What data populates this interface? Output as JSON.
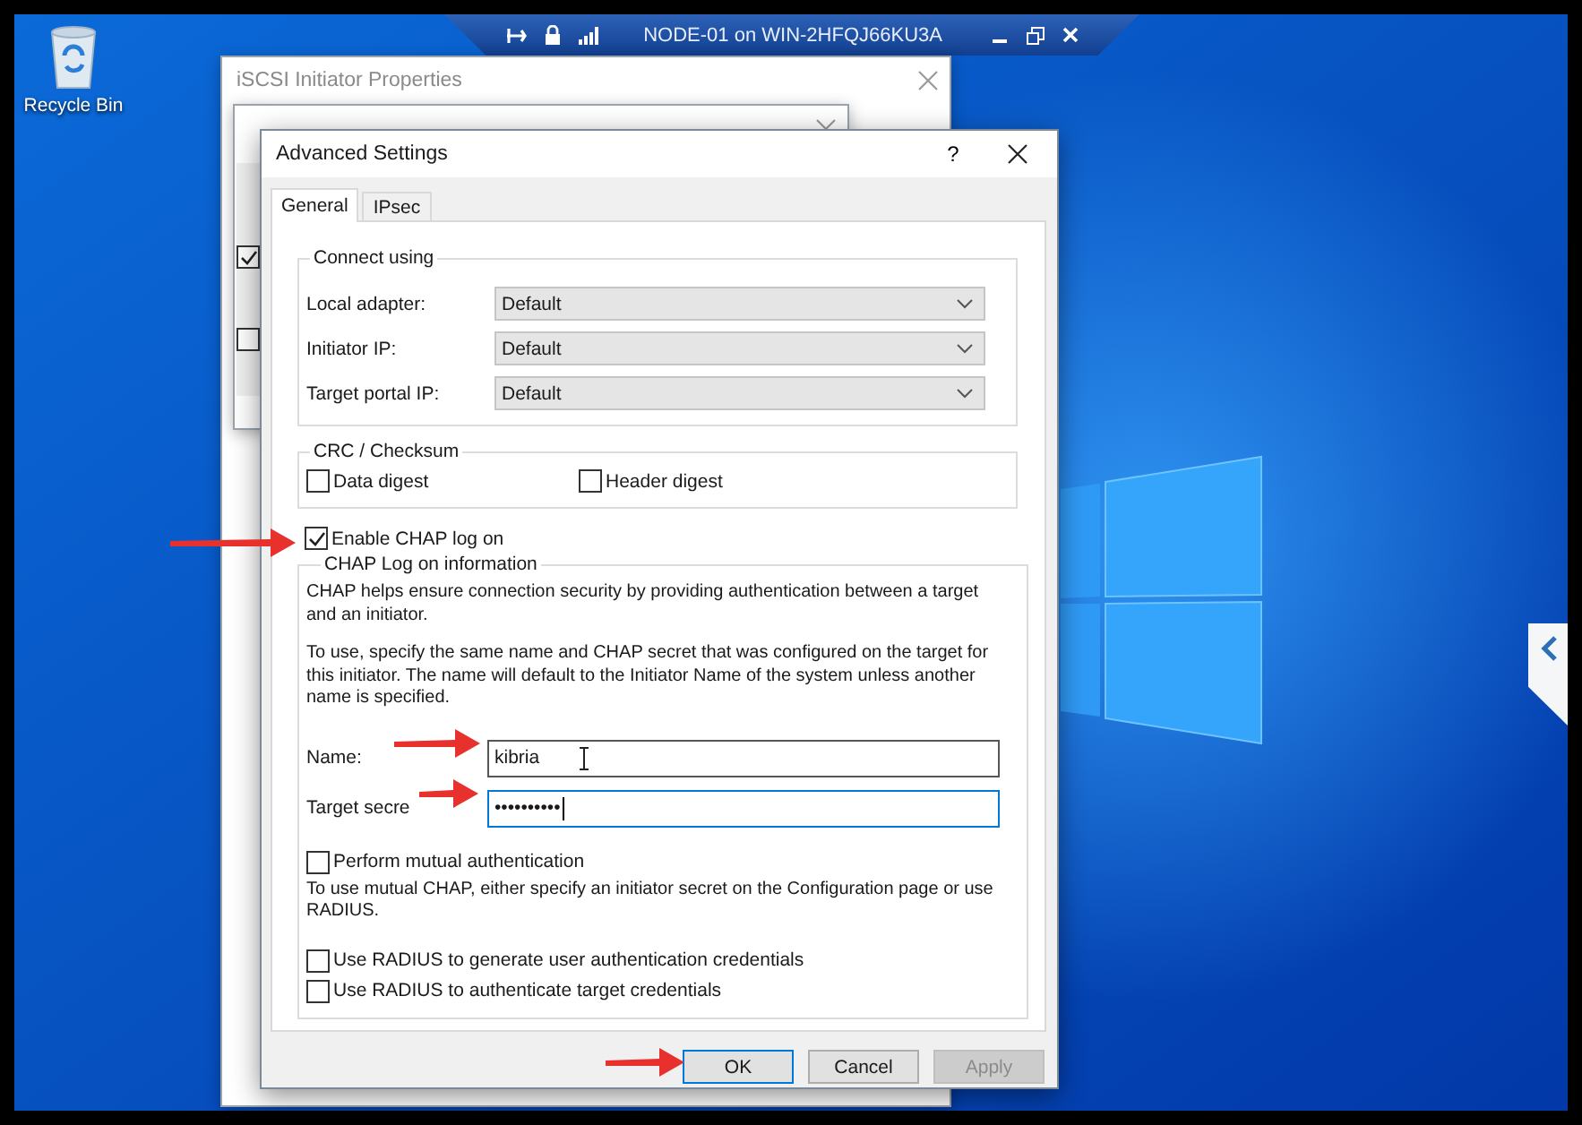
{
  "desktop": {
    "icons": [
      {
        "label": "Recycle Bin"
      }
    ]
  },
  "connection_bar": {
    "title": "NODE-01 on WIN-2HFQJ66KU3A"
  },
  "iscsi_window": {
    "title": "iSCSI Initiator Properties",
    "active": false
  },
  "connect_window": {
    "checkboxes": [
      {
        "checked": true
      },
      {
        "checked": false
      }
    ]
  },
  "advanced_settings": {
    "title": "Advanced Settings",
    "help": "?",
    "tabs": [
      {
        "label": "General",
        "selected": true
      },
      {
        "label": "IPsec",
        "selected": false
      }
    ],
    "connect_using": {
      "legend": "Connect using",
      "rows": [
        {
          "label": "Local adapter:",
          "value": "Default"
        },
        {
          "label": "Initiator IP:",
          "value": "Default"
        },
        {
          "label": "Target portal IP:",
          "value": "Default"
        }
      ]
    },
    "crc": {
      "legend": "CRC / Checksum",
      "checkboxes": [
        {
          "label": "Data digest",
          "checked": false
        },
        {
          "label": "Header digest",
          "checked": false
        }
      ]
    },
    "enable_chap": {
      "label": "Enable CHAP log on",
      "checked": true
    },
    "chap": {
      "legend": "CHAP Log on information",
      "paragraphs": [
        "CHAP helps ensure connection security by providing authentication between a target and an initiator.",
        "To use, specify the same name and CHAP secret that was configured on the target for this initiator.  The name will default to the Initiator Name of the system unless another name is specified."
      ],
      "fields": [
        {
          "label": "Name:",
          "value": "kibria",
          "focused": false
        },
        {
          "label": "Target secre",
          "value": "••••••••••",
          "focused": true
        }
      ],
      "mutual": {
        "label": "Perform mutual authentication",
        "checked": false
      },
      "mutual_note": "To use mutual CHAP, either specify an initiator secret on the Configuration page or use RADIUS.",
      "radius": [
        {
          "label": "Use RADIUS to generate user authentication credentials",
          "checked": false
        },
        {
          "label": "Use RADIUS to authenticate target credentials",
          "checked": false
        }
      ]
    },
    "buttons": [
      {
        "label": "OK",
        "default": true,
        "disabled": false
      },
      {
        "label": "Cancel",
        "default": false,
        "disabled": false
      },
      {
        "label": "Apply",
        "default": false,
        "disabled": true
      }
    ]
  }
}
